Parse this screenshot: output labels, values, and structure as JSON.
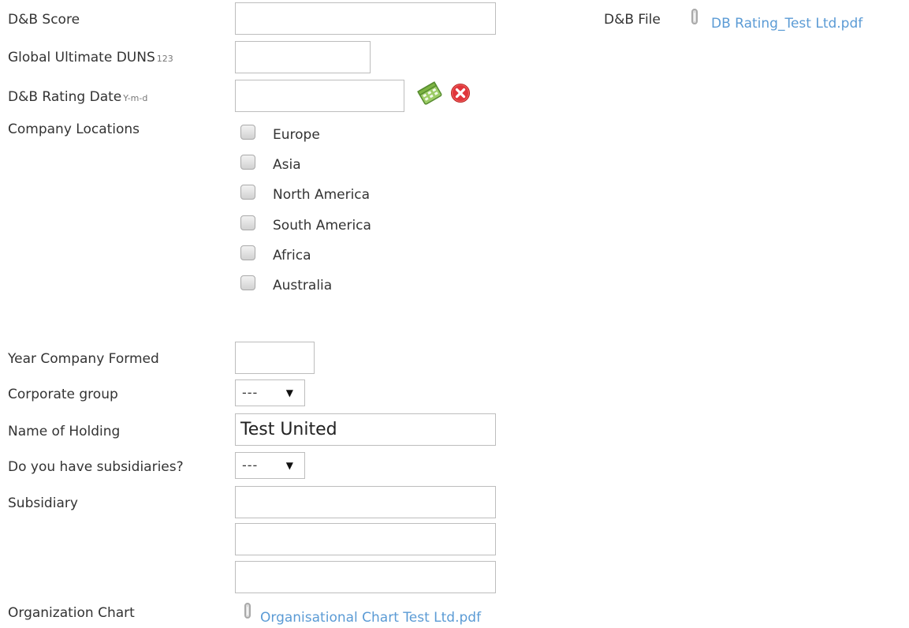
{
  "db_score": {
    "label": "D&B Score",
    "value": ""
  },
  "db_file": {
    "label": "D&B File",
    "attachment_icon": "paperclip-icon",
    "link_text": "DB Rating_Test Ltd.pdf"
  },
  "global_duns": {
    "label": "Global Ultimate DUNS",
    "hint": "123",
    "value": ""
  },
  "rating_date": {
    "label": "D&B Rating Date",
    "hint": "Y-m-d",
    "value": "",
    "calendar_icon": "calendar-icon",
    "clear_icon": "clear-icon"
  },
  "locations": {
    "label": "Company Locations",
    "options": [
      "Europe",
      "Asia",
      "North America",
      "South America",
      "Africa",
      "Australia"
    ]
  },
  "year_formed": {
    "label": "Year Company Formed",
    "value": ""
  },
  "corporate_group": {
    "label": "Corporate group",
    "selected": "---"
  },
  "holding": {
    "label": "Name of Holding",
    "value": "Test United"
  },
  "subsidiaries_question": {
    "label": "Do you have subsidiaries?",
    "selected": "---"
  },
  "subsidiary": {
    "label": "Subsidiary",
    "values": [
      "",
      "",
      ""
    ]
  },
  "org_chart": {
    "label": "Organization Chart",
    "attachment_icon": "paperclip-icon",
    "link_text": "Organisational Chart Test Ltd.pdf"
  },
  "colors": {
    "link": "#5b9bd5",
    "text": "#333333",
    "input_border": "#bdbdbd",
    "clear_icon": "#e0363c",
    "calendar_icon": "#7cb342"
  }
}
